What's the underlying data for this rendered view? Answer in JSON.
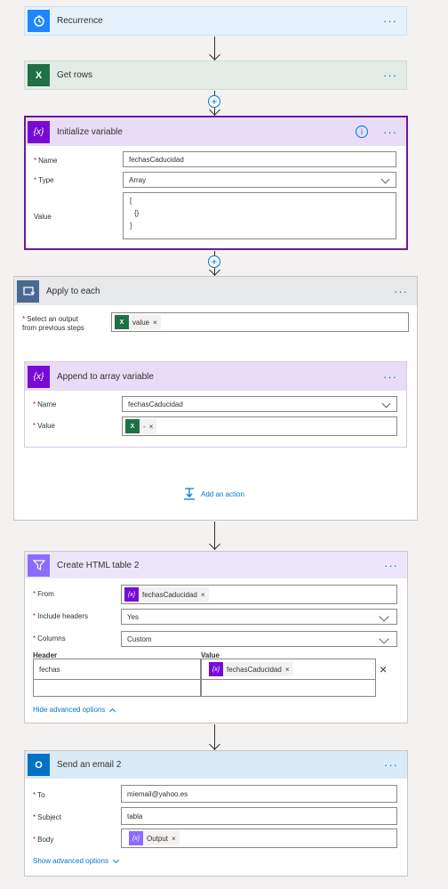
{
  "colors": {
    "recurrence_bg": "#e6f2fb",
    "recurrence_icon": "#1f85ff",
    "excel_bg": "#e3ebe6",
    "excel_icon": "#1e7145",
    "variable_bg": "#e9dcf6",
    "variable_icon": "#770bd6",
    "apply_bg": "#e7e8ea",
    "apply_icon": "#486991",
    "html_table_bg": "#ede6fa",
    "html_table_icon": "#8c6cff",
    "outlook_bg": "#dbeaf7",
    "outlook_icon": "#0072c6",
    "link": "#0078d4",
    "required": "#a4262c",
    "selected_border": "#6a1b9a"
  },
  "more_menu_glyph": "···",
  "add_step_glyph": "+",
  "steps": {
    "recurrence": {
      "title": "Recurrence",
      "icon": "clock-icon"
    },
    "get_rows": {
      "title": "Get rows",
      "icon": "excel-icon",
      "icon_text": "X"
    },
    "init_variable": {
      "title": "Initialize variable",
      "icon": "variable-icon",
      "icon_text": "{x}",
      "info_icon": "i",
      "fields": {
        "name_label": "Name",
        "name_value": "fechasCaducidad",
        "type_label": "Type",
        "type_value": "Array",
        "value_label": "Value",
        "value_lines": [
          "[",
          "{}",
          "]"
        ]
      }
    },
    "apply_each": {
      "title": "Apply to each",
      "icon": "loop-icon",
      "select_label_1": "Select an output",
      "select_label_2": "from previous steps",
      "select_token": "value",
      "add_action": "Add an action",
      "append": {
        "title": "Append to array variable",
        "icon": "variable-icon",
        "icon_text": "{x}",
        "name_label": "Name",
        "name_value": "fechasCaducidad",
        "value_label": "Value",
        "value_token": "-"
      }
    },
    "html_table": {
      "title": "Create HTML table 2",
      "icon": "filter-icon",
      "from_label": "From",
      "from_token": "fechasCaducidad",
      "include_headers_label": "Include headers",
      "include_headers_value": "Yes",
      "columns_label": "Columns",
      "columns_value": "Custom",
      "header_col": "Header",
      "value_col": "Value",
      "row1_header": "fechas",
      "row1_value_token": "fechasCaducidad",
      "delete_glyph": "×",
      "advanced_link": "Hide advanced options"
    },
    "send_email": {
      "title": "Send an email 2",
      "icon": "outlook-icon",
      "icon_text": "O",
      "to_label": "To",
      "to_value": "miemail@yahoo.es",
      "subject_label": "Subject",
      "subject_value": "tabla",
      "body_label": "Body",
      "body_token": "Output",
      "advanced_link": "Show advanced options"
    }
  }
}
